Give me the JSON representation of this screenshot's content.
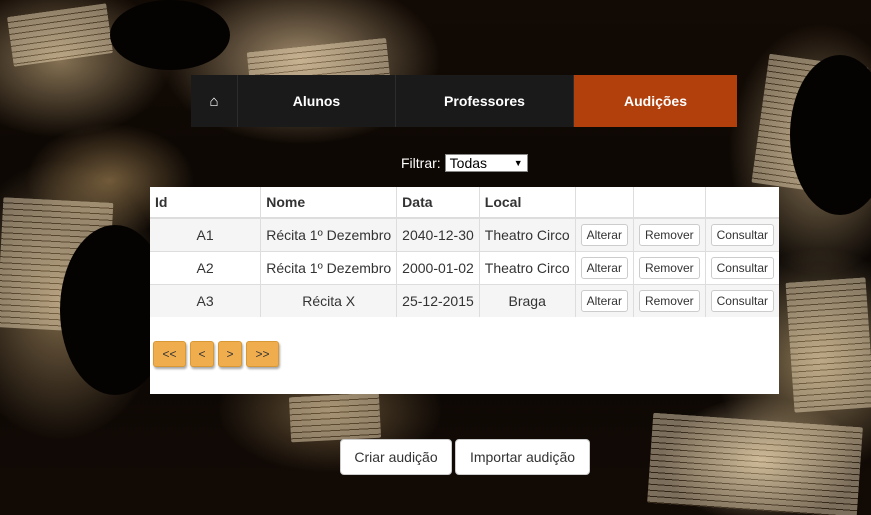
{
  "nav": {
    "home_icon": "home-icon",
    "home_glyph": "⌂",
    "items": [
      {
        "label": "Alunos"
      },
      {
        "label": "Professores"
      },
      {
        "label": "Audições"
      }
    ],
    "active_color": "#b2400c"
  },
  "filter": {
    "label": "Filtrar:",
    "selected": "Todas"
  },
  "table": {
    "headers": [
      "Id",
      "Nome",
      "Data",
      "Local"
    ],
    "rows": [
      {
        "id": "A1",
        "nome": "Récita 1º Dezembro",
        "data": "2040-12-30",
        "local": "Theatro Circo"
      },
      {
        "id": "A2",
        "nome": "Récita 1º Dezembro",
        "data": "2000-01-02",
        "local": "Theatro Circo"
      },
      {
        "id": "A3",
        "nome": "Récita X",
        "data": "25-12-2015",
        "local": "Braga"
      }
    ],
    "actions": {
      "edit": "Alterar",
      "remove": "Remover",
      "view": "Consultar"
    }
  },
  "pagination": {
    "first": "<<",
    "prev": "<",
    "next": ">",
    "last": ">>",
    "color": "#f0ad4e"
  },
  "footer_buttons": {
    "create": "Criar audição",
    "import": "Importar audição"
  }
}
